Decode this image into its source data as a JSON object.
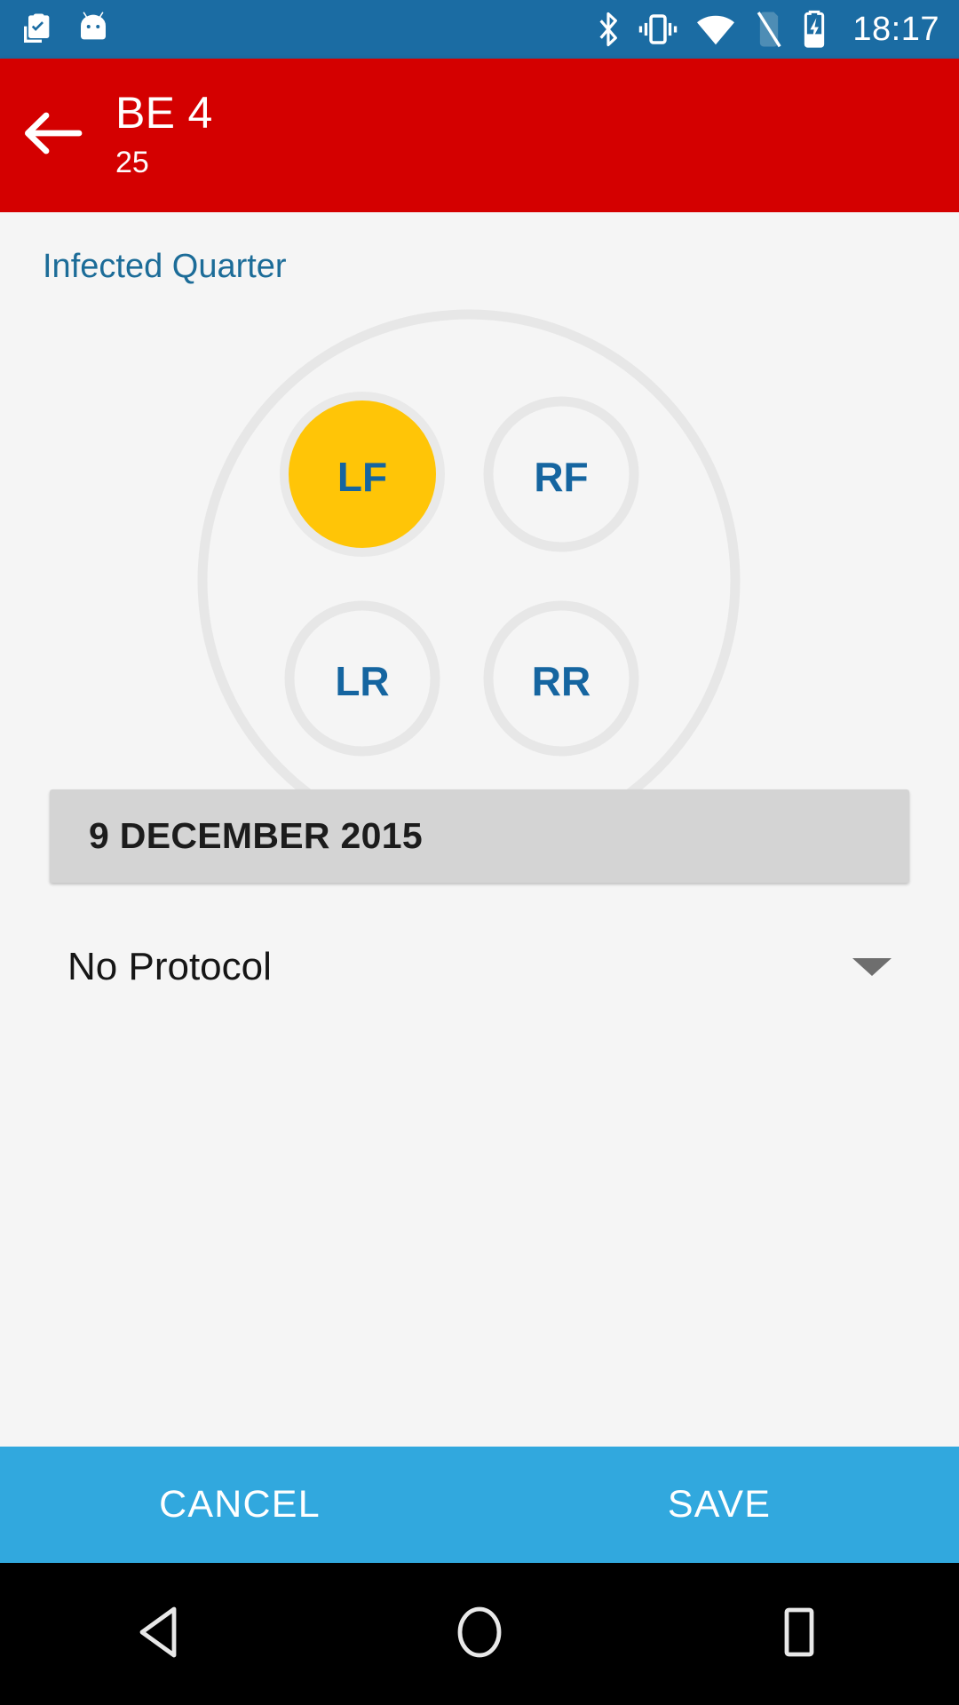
{
  "statusbar": {
    "clock": "18:17",
    "left_icons": [
      {
        "name": "work-profile-clipboard-icon"
      },
      {
        "name": "cyanogenmod-android-head-icon"
      }
    ],
    "right_icons": [
      {
        "name": "bluetooth-icon"
      },
      {
        "name": "vibrate-mode-icon"
      },
      {
        "name": "wifi-icon"
      },
      {
        "name": "no-sim-card-icon"
      },
      {
        "name": "battery-charging-icon"
      }
    ],
    "background_color": "#1b6ca3"
  },
  "appbar": {
    "back_label": "back-arrow",
    "title": "BE 4",
    "subtitle": "25",
    "background_color": "#d40000"
  },
  "form": {
    "section_label": "Infected Quarter",
    "quarters": [
      {
        "id": "LF",
        "label": "LF",
        "selected": true
      },
      {
        "id": "RF",
        "label": "RF",
        "selected": false
      },
      {
        "id": "LR",
        "label": "LR",
        "selected": false
      },
      {
        "id": "RR",
        "label": "RR",
        "selected": false
      }
    ],
    "selected_quarter_color": "#FFC507",
    "quarter_text_color": "#1565a0",
    "outline_color": "#e6e6e6",
    "date_value": "9 DECEMBER 2015",
    "protocol_value": "No Protocol",
    "protocol_caret": "chevron-down-icon"
  },
  "actionbar": {
    "cancel_label": "CANCEL",
    "save_label": "SAVE",
    "background_color": "#31a8de"
  },
  "navbar": {
    "back": "nav-back-triangle",
    "home": "nav-home-circle",
    "recents": "nav-recents-square"
  }
}
